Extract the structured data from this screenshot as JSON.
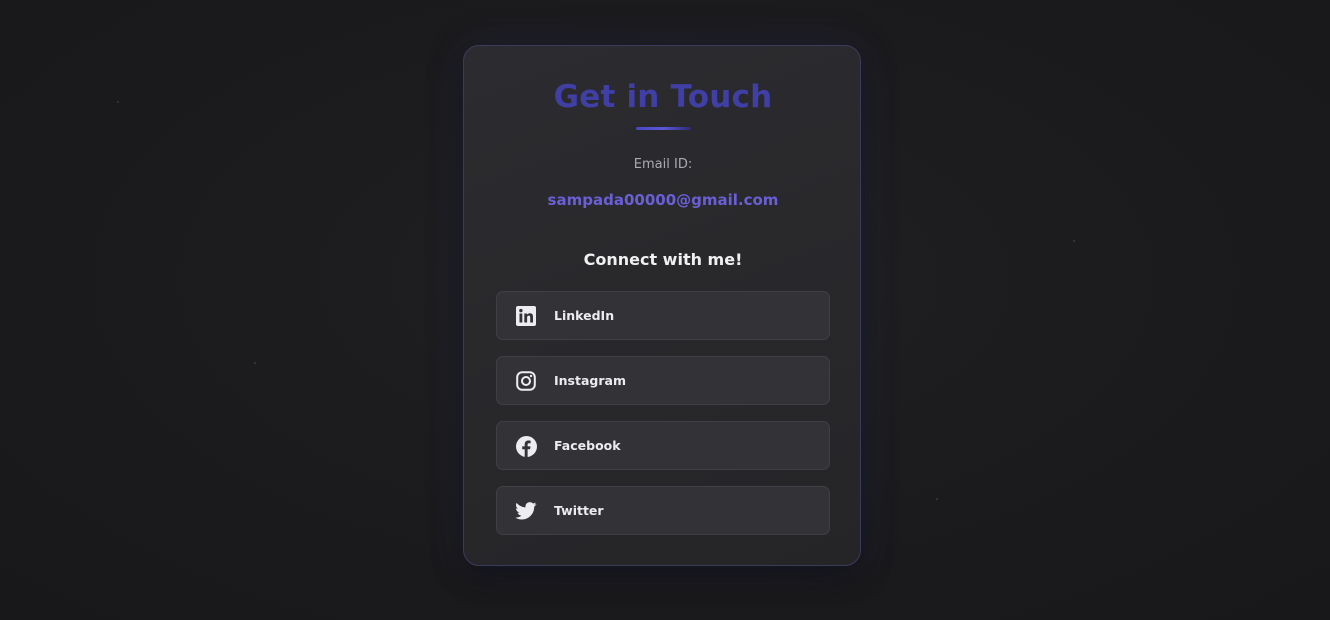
{
  "card": {
    "title": "Get in Touch",
    "email_label": "Email ID:",
    "email_value": "sampada00000@gmail.com",
    "connect_heading": "Connect with me!"
  },
  "social_links": [
    {
      "label": "LinkedIn",
      "icon": "linkedin-icon"
    },
    {
      "label": "Instagram",
      "icon": "instagram-icon"
    },
    {
      "label": "Facebook",
      "icon": "facebook-icon"
    },
    {
      "label": "Twitter",
      "icon": "twitter-icon"
    }
  ],
  "colors": {
    "background": "#1a1a1c",
    "card": "#2a2a2d",
    "accent": "#3f3fa6",
    "email": "#6a5fd6",
    "button": "#333337",
    "text": "#ececf0"
  }
}
